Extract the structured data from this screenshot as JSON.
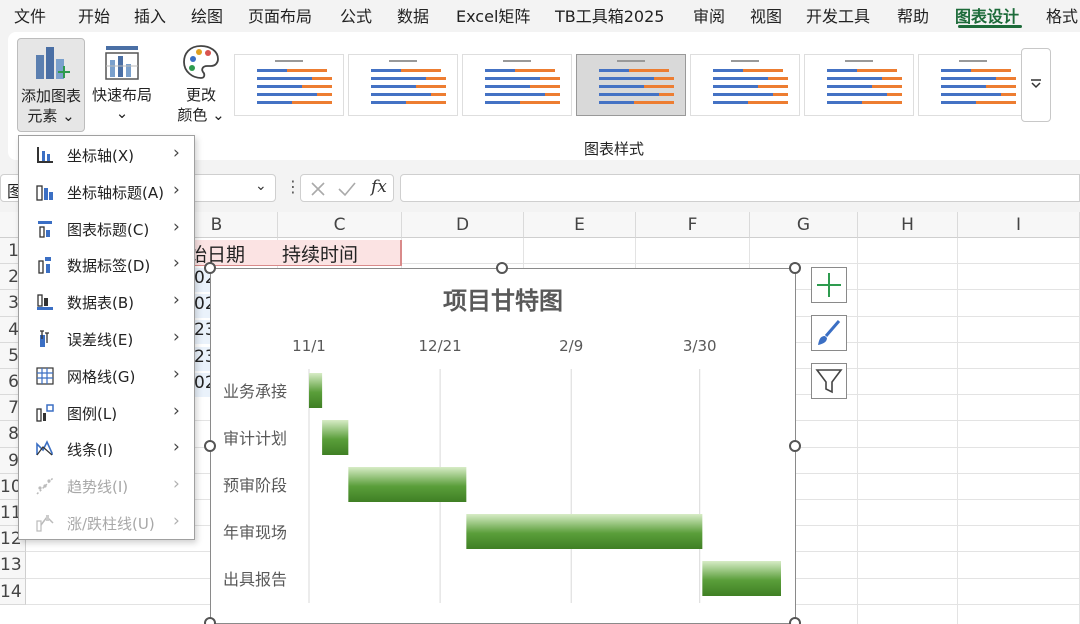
{
  "ribbon": {
    "tabs": [
      "文件",
      "开始",
      "插入",
      "绘图",
      "页面布局",
      "公式",
      "数据",
      "Excel矩阵",
      "TB工具箱2025",
      "审阅",
      "视图",
      "开发工具",
      "帮助",
      "图表设计",
      "格式"
    ],
    "active_tab": "图表设计",
    "add_element_label_1": "添加图表",
    "add_element_label_2": "元素",
    "quick_layout_label": "快速布局",
    "change_color_label_1": "更改",
    "change_color_label_2": "颜色",
    "styles_group_label": "图表样式"
  },
  "formula_bar": {
    "name_box": "图",
    "fx": "fx"
  },
  "sheet": {
    "columns": [
      "B",
      "C",
      "D",
      "E",
      "F",
      "G",
      "H",
      "I"
    ],
    "rows": [
      "1",
      "2",
      "3",
      "4",
      "5",
      "6",
      "7",
      "8",
      "9",
      "10",
      "11",
      "12",
      "13",
      "14"
    ],
    "b1": "始日期",
    "c1": "持续时间",
    "b_fragments": [
      "02",
      "02",
      "23",
      "23",
      "02"
    ]
  },
  "dropdown": {
    "items": [
      {
        "label": "坐标轴(X)",
        "enabled": true
      },
      {
        "label": "坐标轴标题(A)",
        "enabled": true
      },
      {
        "label": "图表标题(C)",
        "enabled": true
      },
      {
        "label": "数据标签(D)",
        "enabled": true
      },
      {
        "label": "数据表(B)",
        "enabled": true
      },
      {
        "label": "误差线(E)",
        "enabled": true
      },
      {
        "label": "网格线(G)",
        "enabled": true
      },
      {
        "label": "图例(L)",
        "enabled": true
      },
      {
        "label": "线条(I)",
        "enabled": true
      },
      {
        "label": "趋势线(I)",
        "enabled": false
      },
      {
        "label": "涨/跌柱线(U)",
        "enabled": false
      }
    ]
  },
  "chart_data": {
    "type": "bar",
    "title": "项目甘特图",
    "x_ticks": [
      "11/1",
      "12/21",
      "2/9",
      "3/30"
    ],
    "x_tick_days": [
      0,
      50,
      100,
      149
    ],
    "categories": [
      "业务承接",
      "审计计划",
      "预审阶段",
      "年审现场",
      "出具报告"
    ],
    "start_days": [
      0,
      5,
      15,
      60,
      150
    ],
    "durations": [
      5,
      10,
      45,
      90,
      30
    ],
    "xlim": [
      0,
      180
    ],
    "bar_color": "#5a9e3a",
    "grid": true
  },
  "colors": {
    "accent": "#1d6b3a",
    "add_icon": "#2e9b4f"
  }
}
